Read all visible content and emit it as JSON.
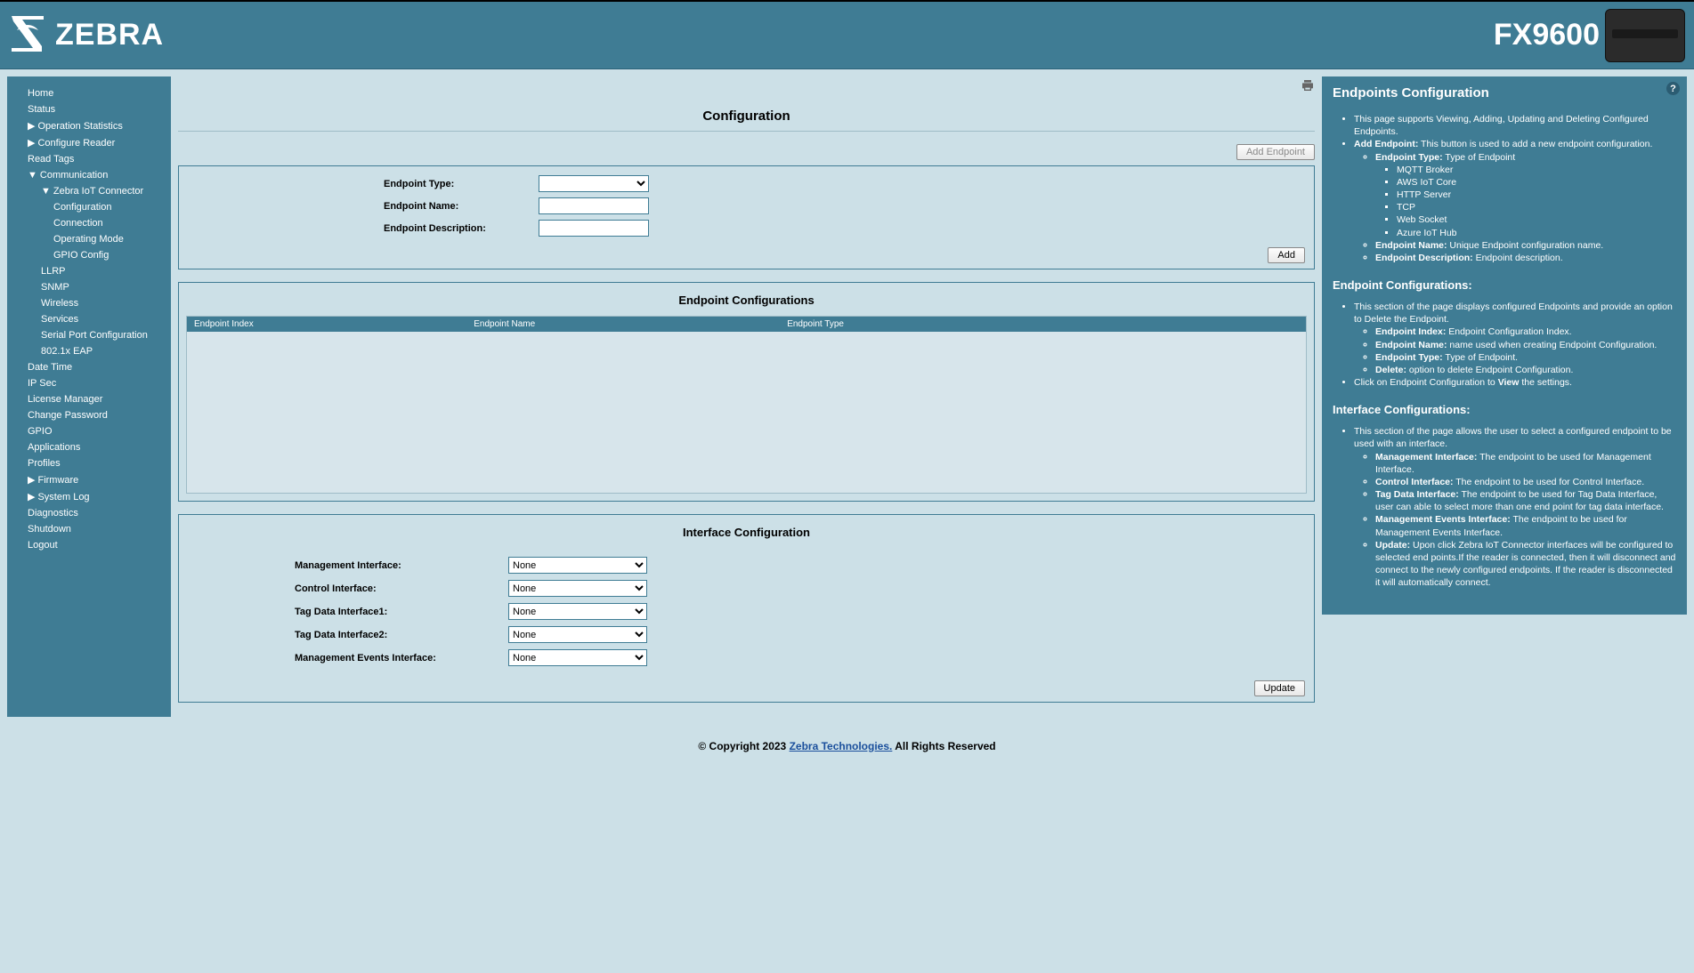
{
  "header": {
    "brand": "ZEBRA",
    "product": "FX9600"
  },
  "nav": {
    "home": "Home",
    "status": "Status",
    "op_stats": "Operation Statistics",
    "cfg_reader": "Configure Reader",
    "read_tags": "Read Tags",
    "communication": "Communication",
    "zebra_iot": "Zebra IoT Connector",
    "configuration": "Configuration",
    "connection": "Connection",
    "operating_mode": "Operating Mode",
    "gpio_config": "GPIO Config",
    "llrp": "LLRP",
    "snmp": "SNMP",
    "wireless": "Wireless",
    "services": "Services",
    "serial": "Serial Port Configuration",
    "eap": "802.1x EAP",
    "date_time": "Date Time",
    "ipsec": "IP Sec",
    "license": "License Manager",
    "change_pw": "Change Password",
    "gpio": "GPIO",
    "applications": "Applications",
    "profiles": "Profiles",
    "firmware": "Firmware",
    "syslog": "System Log",
    "diagnostics": "Diagnostics",
    "shutdown": "Shutdown",
    "logout": "Logout"
  },
  "main": {
    "title": "Configuration",
    "add_endpoint_btn": "Add Endpoint",
    "labels": {
      "type": "Endpoint Type:",
      "name": "Endpoint Name:",
      "desc": "Endpoint Description:"
    },
    "add_btn": "Add",
    "endpoint_configs_title": "Endpoint Configurations",
    "cols": {
      "index": "Endpoint Index",
      "name": "Endpoint Name",
      "type": "Endpoint Type"
    },
    "iface_title": "Interface Configuration",
    "iface": {
      "mgmt": "Management Interface:",
      "ctrl": "Control Interface:",
      "tag1": "Tag Data Interface1:",
      "tag2": "Tag Data Interface2:",
      "mgmt_events": "Management Events Interface:"
    },
    "select_none": "None",
    "update_btn": "Update"
  },
  "right": {
    "title": "Endpoints Configuration",
    "b1": "This page supports Viewing, Adding, Updating and Deleting Configured Endpoints.",
    "b2_label": "Add Endpoint:",
    "b2_text": " This button is used to add a new endpoint configuration.",
    "type_label": "Endpoint Type:",
    "type_text": " Type of Endpoint",
    "types": [
      "MQTT Broker",
      "AWS IoT Core",
      "HTTP Server",
      "TCP",
      "Web Socket",
      "Azure IoT Hub"
    ],
    "name_label": "Endpoint Name:",
    "name_text": " Unique Endpoint configuration name.",
    "desc_label": "Endpoint Description:",
    "desc_text": " Endpoint description.",
    "ec_title": "Endpoint Configurations:",
    "ec1": "This section of the page displays configured Endpoints and provide an option to Delete the Endpoint.",
    "ec_idx_label": "Endpoint Index:",
    "ec_idx_text": " Endpoint Configuration Index.",
    "ec_name_label": "Endpoint Name:",
    "ec_name_text": " name used when creating Endpoint Configuration.",
    "ec_type_label": "Endpoint Type:",
    "ec_type_text": " Type of Endpoint.",
    "ec_del_label": "Delete:",
    "ec_del_text": " option to delete Endpoint Configuration.",
    "ec_click_pre": "Click on Endpoint Configuration to ",
    "ec_click_b": "View",
    "ec_click_post": " the settings.",
    "ic_title": "Interface Configurations:",
    "ic1": "This section of the page allows the user to select a configured endpoint to be used with an interface.",
    "ic_mgmt_label": "Management Interface:",
    "ic_mgmt_text": " The endpoint to be used for Management Interface.",
    "ic_ctrl_label": "Control Interface:",
    "ic_ctrl_text": " The endpoint to be used for Control Interface.",
    "ic_tag_label": "Tag Data Interface:",
    "ic_tag_text": " The endpoint to be used for Tag Data Interface, user can able to select more than one end point for tag data interface.",
    "ic_me_label": "Management Events Interface:",
    "ic_me_text": " The endpoint to be used for Management Events Interface.",
    "ic_upd_label": "Update:",
    "ic_upd_text": " Upon click Zebra IoT Connector interfaces will be configured to selected end points.If the reader is connected, then it will disconnect and connect to the newly configured endpoints. If the reader is disconnected it will automatically connect."
  },
  "footer": {
    "pre": "© Copyright 2023 ",
    "link": "Zebra Technologies.",
    "post": " All Rights Reserved"
  }
}
